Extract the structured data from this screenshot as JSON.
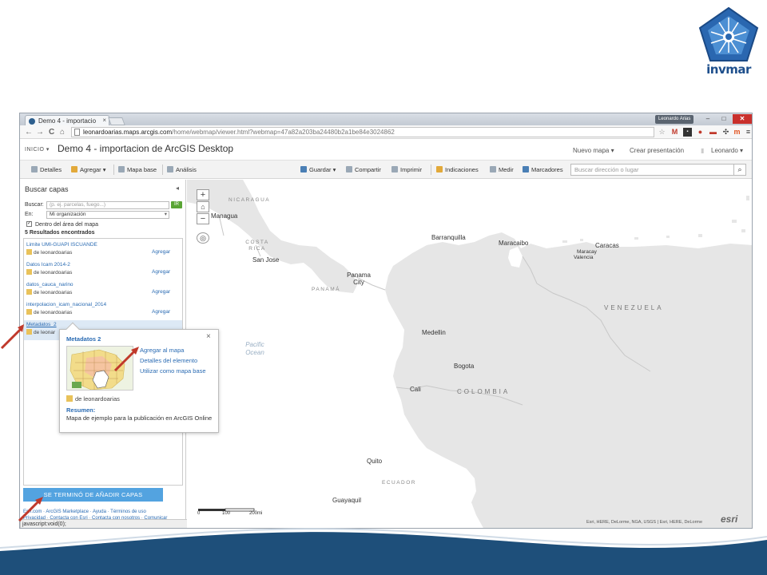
{
  "logo": {
    "text": "invmar",
    "icon": "invemar-logo-icon"
  },
  "browser": {
    "tab_title": "Demo 4 - importacio",
    "tab_close": "×",
    "user_chip": "Leonardo Arias",
    "url_host": "leonardoarias.maps.arcgis.com",
    "url_path": "/home/webmap/viewer.html?webmap=47a82a203ba24480b2a1be84e3024862",
    "back": "←",
    "forward": "→",
    "reload": "C",
    "home": "⌂",
    "min": "–",
    "max": "□",
    "close": "✕"
  },
  "header": {
    "inicio": "INICIO ▾",
    "title": "Demo 4 - importacion de ArcGIS Desktop",
    "new_map": "Nuevo mapa ▾",
    "create_presentation": "Crear presentación",
    "user": "Leonardo ▾"
  },
  "toolbar": {
    "details": "Detalles",
    "add": "Agregar ▾",
    "basemap": "Mapa base",
    "analysis": "Análisis",
    "save": "Guardar ▾",
    "share": "Compartir",
    "print": "Imprimir",
    "directions": "Indicaciones",
    "measure": "Medir",
    "bookmarks": "Marcadores",
    "search_placeholder": "Buscar dirección o lugar"
  },
  "panel": {
    "title": "Buscar capas",
    "search_label": "Buscar:",
    "search_placeholder": "(p. ej. parcelas, fuego...)",
    "go": "IR",
    "in_label": "En:",
    "in_value": "Mi organización",
    "within_map": "Dentro del área del mapa",
    "results_count": "5 Resultados encontrados",
    "results": [
      {
        "title": "Limite UMI-GUAPI ISCUANDE",
        "owner": "de leonardoarias",
        "action": "Agregar"
      },
      {
        "title": "Datos Icam 2014-2",
        "owner": "de leonardoarias",
        "action": "Agregar"
      },
      {
        "title": "datos_cauca_narino",
        "owner": "de leonardoarias",
        "action": "Agregar"
      },
      {
        "title": "interpolacion_icam_nacional_2014",
        "owner": "de leonardoarias",
        "action": "Agregar"
      },
      {
        "title": "Metadatos_2",
        "owner": "de leonar",
        "action": ""
      }
    ],
    "done_button": "SE TERMINÓ DE AÑADIR CAPAS",
    "footer_line1": "Esri.com · ArcGIS Marketplace · Ayuda · Términos de uso",
    "footer_line2": "Privacidad · Contacta con Esri · Contacta con nosotros · Comunicar",
    "status": "javascript:void(0);"
  },
  "popup": {
    "title": "Metadatos 2",
    "close": "×",
    "add_to_map": "Agregar al mapa",
    "item_details": "Detalles del elemento",
    "use_as_basemap": "Utilizar como mapa base",
    "owner": "de leonardoarias",
    "summary_label": "Resumen:",
    "summary_text": "Mapa de ejemplo para la publicación en ArcGIS Online"
  },
  "map": {
    "zoom_in": "+",
    "zoom_out": "−",
    "countries": [
      "NICARAGUA",
      "COSTA RICA",
      "PANAMÁ",
      "VENEZUELA",
      "COLOMBIA",
      "ECUADOR"
    ],
    "cities": [
      "Managua",
      "San Jose",
      "Panama City",
      "Barranquilla",
      "Maracaibo",
      "Caracas",
      "Maracay",
      "Valencia",
      "Medellin",
      "Bogota",
      "Cali",
      "Quito",
      "Guayaquil"
    ],
    "ocean": "Pacific Ocean",
    "scale_labels": [
      "0",
      "100",
      "200mi"
    ],
    "attribution": "Esri, HERE, DeLorme, NGA, USGS | Esri, HERE, DeLorme",
    "esri": "esri"
  },
  "colors": {
    "accent": "#53a3e0",
    "link": "#2a6bb3",
    "wave": "#1e4f7a",
    "arrow": "#c0392b"
  }
}
